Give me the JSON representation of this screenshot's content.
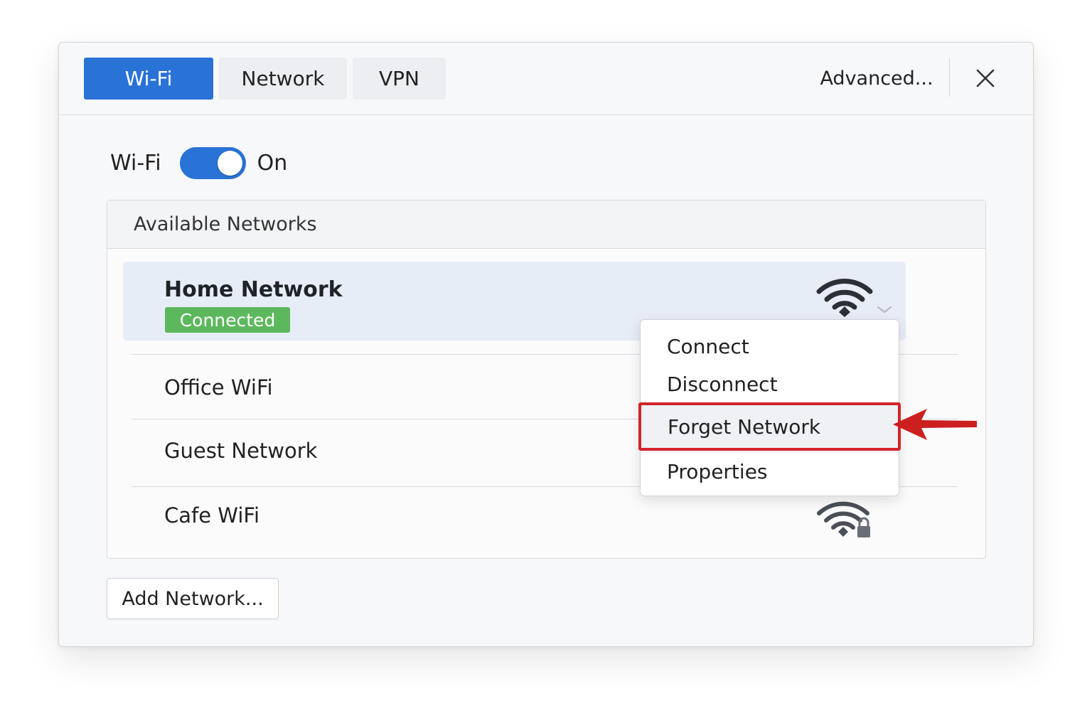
{
  "tabs": [
    {
      "label": "Wi-Fi",
      "active": true
    },
    {
      "label": "Network",
      "active": false
    },
    {
      "label": "VPN",
      "active": false
    }
  ],
  "header": {
    "advanced_label": "Advanced...",
    "close_icon": "close-icon"
  },
  "wifi_toggle": {
    "label": "Wi-Fi",
    "state": "On",
    "enabled": true
  },
  "networks_panel": {
    "header": "Available Networks",
    "items": [
      {
        "name": "Home Network",
        "status": "Connected",
        "selected": true,
        "icon": "wifi-signal-icon"
      },
      {
        "name": "Office WiFi",
        "selected": false
      },
      {
        "name": "Guest Network",
        "selected": false
      },
      {
        "name": "Cafe WiFi",
        "selected": false,
        "icon": "wifi-locked-icon"
      }
    ]
  },
  "add_network_label": "Add Network...",
  "context_menu": {
    "items": [
      {
        "label": "Connect"
      },
      {
        "label": "Disconnect"
      },
      {
        "label": "Forget Network",
        "highlighted": true
      },
      {
        "label": "Properties"
      }
    ]
  },
  "colors": {
    "accent": "#2a73d6",
    "connected_badge": "#5cb85c",
    "highlight_border": "#d0242a",
    "arrow": "#cc1f1f"
  }
}
